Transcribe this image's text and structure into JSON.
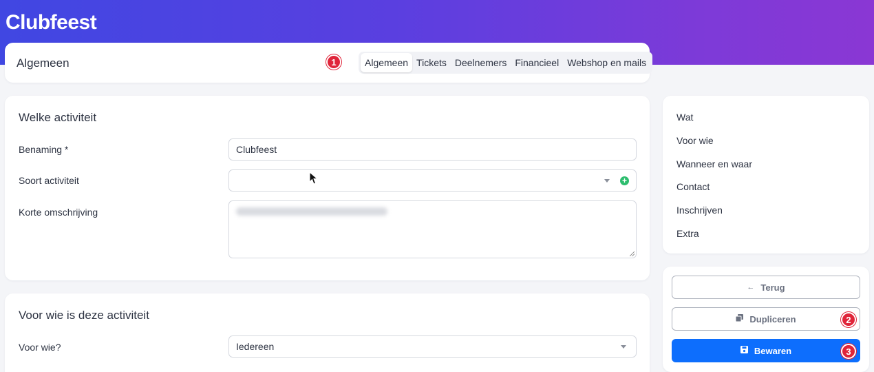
{
  "app": {
    "title": "Clubfeest"
  },
  "tabs_header": {
    "title": "Algemeen",
    "badge": "1",
    "tabs": [
      {
        "label": "Algemeen",
        "active": true
      },
      {
        "label": "Tickets",
        "active": false
      },
      {
        "label": "Deelnemers",
        "active": false
      },
      {
        "label": "Financieel",
        "active": false
      },
      {
        "label": "Webshop en mails",
        "active": false
      }
    ]
  },
  "section1": {
    "title": "Welke activiteit",
    "fields": {
      "benaming": {
        "label": "Benaming *",
        "value": "Clubfeest"
      },
      "soort": {
        "label": "Soort activiteit",
        "value": ""
      },
      "omschrijving": {
        "label": "Korte omschrijving"
      }
    }
  },
  "section2": {
    "title": "Voor wie is deze activiteit",
    "fields": {
      "voor_wie": {
        "label": "Voor wie?",
        "value": "Iedereen"
      }
    }
  },
  "side_nav": {
    "items": [
      "Wat",
      "Voor wie",
      "Wanneer en waar",
      "Contact",
      "Inschrijven",
      "Extra"
    ]
  },
  "actions": {
    "back": {
      "label": "Terug",
      "icon": "arrow-left-icon"
    },
    "duplicate": {
      "label": "Dupliceren",
      "icon": "copy-icon",
      "badge": "2"
    },
    "save": {
      "label": "Bewaren",
      "icon": "save-icon",
      "badge": "3"
    }
  },
  "colors": {
    "header_gradient_start": "#4047e2",
    "header_gradient_end": "#8a37d4",
    "primary": "#0d6efd",
    "badge": "#e0253a",
    "add": "#2dbd6e"
  }
}
